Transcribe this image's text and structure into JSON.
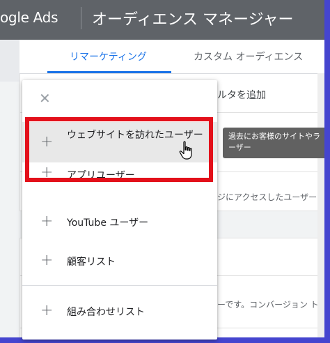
{
  "header": {
    "brand": "ogle Ads",
    "title": "オーディエンス マネージャー"
  },
  "tabs": [
    {
      "label": "リマーケティング",
      "active": true
    },
    {
      "label": "カスタム オーディエンス",
      "active": false
    }
  ],
  "background": {
    "filter_add": "ルタを追加",
    "access_text": "ジにアクセスしたユーザー",
    "conversion_text": "ーです。コンバージョン トラ"
  },
  "tooltip": {
    "line1": "過去にお客様のサイトやラ",
    "line2": "ーザー"
  },
  "dropdown": {
    "close_icon": "close-icon",
    "items": [
      {
        "label": "ウェブサイトを訪れたユーザー"
      },
      {
        "label": "アプリユーザー"
      },
      {
        "label": "YouTube ユーザー"
      },
      {
        "label": "顧客リスト"
      },
      {
        "label": "組み合わせリスト"
      }
    ]
  },
  "colors": {
    "accent": "#1a73e8",
    "highlight": "#e3101a",
    "border_frame": "#4545cf",
    "header_bg": "#5f6368"
  }
}
